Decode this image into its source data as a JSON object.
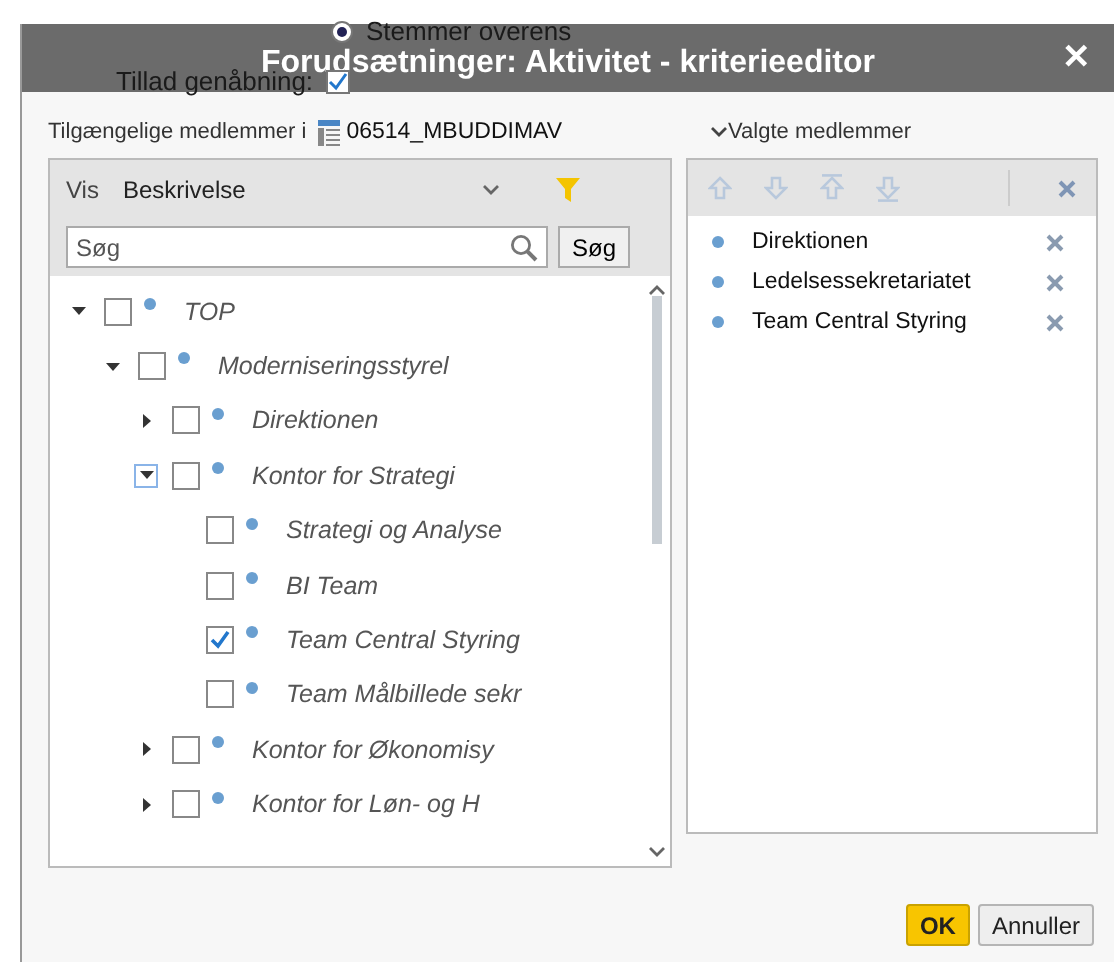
{
  "backdrop": [
    {
      "kind": "radio",
      "label": "Stemmer overens",
      "checked": true
    },
    {
      "kind": "checkbox",
      "label": "Tillad genåbning:",
      "checked": true
    }
  ],
  "dialog": {
    "title": "Forudsætninger: Aktivitet - kriterieeditor",
    "close": "✕"
  },
  "available": {
    "label": "Tilgængelige medlemmer i",
    "dimension": "06514_MBUDDIMAV",
    "view_label": "Vis",
    "view_value": "Beskrivelse",
    "search": {
      "placeholder": "Søg",
      "button": "Søg"
    },
    "tree": [
      {
        "label": "TOP",
        "expanded": true,
        "checked": false,
        "focused": false,
        "children": [
          {
            "label": "Moderniseringsstyrel",
            "expanded": true,
            "checked": false,
            "focused": false,
            "children": [
              {
                "label": "Direktionen",
                "expanded": false,
                "checked": false,
                "focused": false
              },
              {
                "label": "Kontor for Strategi",
                "expanded": true,
                "checked": false,
                "focused": true,
                "children": [
                  {
                    "label": "Strategi og Analyse",
                    "checked": false
                  },
                  {
                    "label": "BI Team",
                    "checked": false
                  },
                  {
                    "label": "Team Central Styring",
                    "checked": true
                  },
                  {
                    "label": "Team Målbillede sekr",
                    "checked": false
                  }
                ]
              },
              {
                "label": "Kontor for Økonomisy",
                "expanded": false,
                "checked": false,
                "focused": false
              },
              {
                "label": "Kontor for Løn- og H",
                "expanded": false,
                "checked": false,
                "focused": false
              }
            ]
          }
        ]
      }
    ]
  },
  "selected_members": {
    "label": "Valgte medlemmer",
    "items": [
      {
        "label": "Direktionen"
      },
      {
        "label": "Ledelsessekretariatet"
      },
      {
        "label": "Team Central Styring"
      }
    ]
  },
  "buttons": [
    {
      "label": "OK",
      "primary": true
    },
    {
      "label": "Annuller",
      "primary": false
    }
  ]
}
